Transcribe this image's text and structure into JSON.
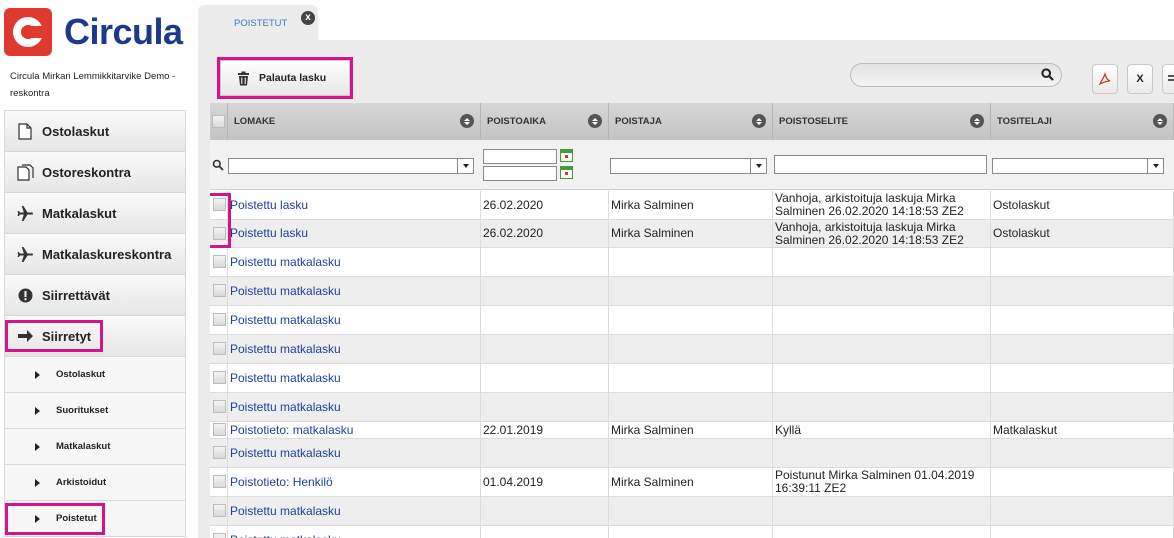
{
  "brand": {
    "name": "Circula",
    "company": "Circula Mirkan Lemmikkitarvike Demo - reskontra"
  },
  "sidebar": {
    "main_items": [
      {
        "label": "Ostolaskut",
        "icon": "document-icon"
      },
      {
        "label": "Ostoreskontra",
        "icon": "documents-icon"
      },
      {
        "label": "Matkalaskut",
        "icon": "airplane-icon"
      },
      {
        "label": "Matkalaskureskontra",
        "icon": "airplane-icon"
      },
      {
        "label": "Siirrettävät",
        "icon": "alert-icon"
      },
      {
        "label": "Siirretyt",
        "icon": "arrow-right-icon"
      }
    ],
    "sub_items": [
      {
        "label": "Ostolaskut"
      },
      {
        "label": "Suoritukset"
      },
      {
        "label": "Matkalaskut"
      },
      {
        "label": "Arkistoidut"
      },
      {
        "label": "Poistetut"
      }
    ],
    "highlight_color": "#d4148c"
  },
  "tab": {
    "label": "POISTETUT",
    "close": "x"
  },
  "toolbar": {
    "restore_label": "Palauta lasku",
    "pdf_label": "",
    "excel_label": "X"
  },
  "grid": {
    "columns": [
      {
        "label": "LOMAKE"
      },
      {
        "label": "POISTOAIKA"
      },
      {
        "label": "POISTAJA"
      },
      {
        "label": "POISTOSELITE"
      },
      {
        "label": "TOSITELAJI"
      }
    ],
    "rows": [
      {
        "lomake": "Poistettu lasku",
        "aika": "26.02.2020",
        "poistaja": "Mirka Salminen",
        "selite": "Vanhoja, arkistoituja laskuja Mirka Salminen 26.02.2020 14:18:53 ZE2",
        "laji": "Ostolaskut"
      },
      {
        "lomake": "Poistettu lasku",
        "aika": "26.02.2020",
        "poistaja": "Mirka Salminen",
        "selite": "Vanhoja, arkistoituja laskuja Mirka Salminen 26.02.2020 14:18:53 ZE2",
        "laji": "Ostolaskut"
      },
      {
        "lomake": "Poistettu matkalasku",
        "aika": "",
        "poistaja": "",
        "selite": "",
        "laji": ""
      },
      {
        "lomake": "Poistettu matkalasku",
        "aika": "",
        "poistaja": "",
        "selite": "",
        "laji": ""
      },
      {
        "lomake": "Poistettu matkalasku",
        "aika": "",
        "poistaja": "",
        "selite": "",
        "laji": ""
      },
      {
        "lomake": "Poistettu matkalasku",
        "aika": "",
        "poistaja": "",
        "selite": "",
        "laji": ""
      },
      {
        "lomake": "Poistettu matkalasku",
        "aika": "",
        "poistaja": "",
        "selite": "",
        "laji": ""
      },
      {
        "lomake": "Poistettu matkalasku",
        "aika": "",
        "poistaja": "",
        "selite": "",
        "laji": ""
      },
      {
        "lomake": "Poistotieto: matkalasku",
        "aika": "22.01.2019",
        "poistaja": "Mirka Salminen",
        "selite": "Kyllä",
        "laji": "Matkalaskut"
      },
      {
        "lomake": "Poistettu matkalasku",
        "aika": "",
        "poistaja": "",
        "selite": "",
        "laji": ""
      },
      {
        "lomake": "Poistotieto: Henkilö",
        "aika": "01.04.2019",
        "poistaja": "Mirka Salminen",
        "selite": "Poistunut Mirka Salminen 01.04.2019 16:39:11 ZE2",
        "laji": ""
      },
      {
        "lomake": "Poistettu matkalasku",
        "aika": "",
        "poistaja": "",
        "selite": "",
        "laji": ""
      },
      {
        "lomake": "Poistettu matkalasku",
        "aika": "",
        "poistaja": "",
        "selite": "",
        "laji": ""
      }
    ]
  }
}
